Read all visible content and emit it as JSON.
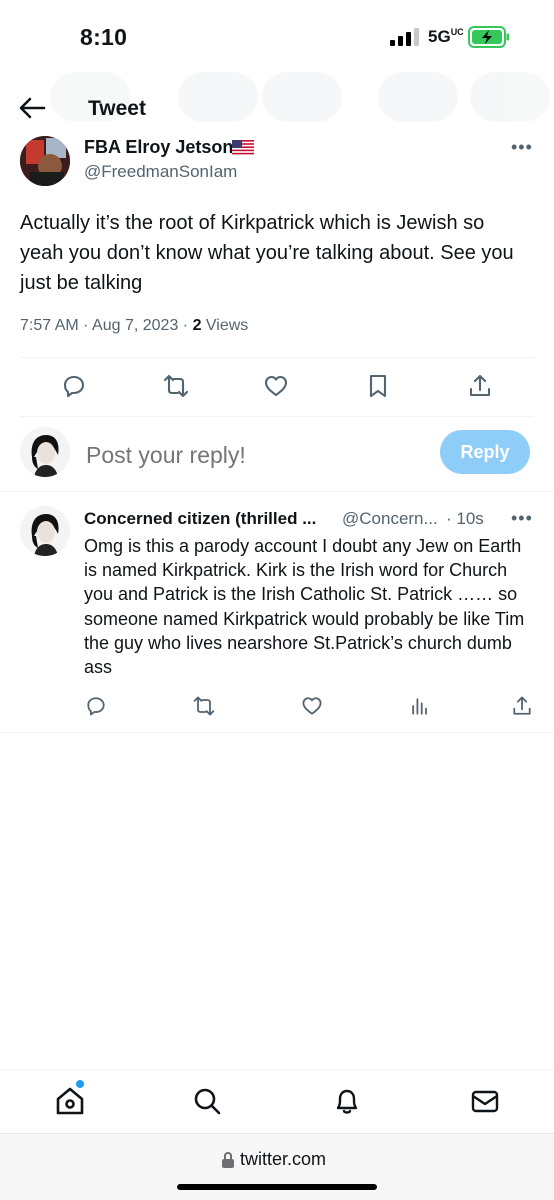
{
  "status_bar": {
    "time": "8:10",
    "network": "5G",
    "network_suffix": "UC",
    "battery_color": "#34c759"
  },
  "header": {
    "title": "Tweet",
    "back_icon": "arrow-left-icon"
  },
  "tweet": {
    "author_name": "FBA Elroy Jetson",
    "author_flag": "us-flag-icon",
    "author_handle": "@FreedmanSonIam",
    "text": "Actually it’s the root of Kirkpatrick which is Jewish so yeah you don’t know what you’re talking about. See you just be talking",
    "time": "7:57 AM · Aug 7, 2023 · ",
    "views_count": "2",
    "views_label": " Views",
    "more_label": "•••",
    "actions": [
      "reply-icon",
      "retweet-icon",
      "like-icon",
      "bookmark-icon",
      "share-icon"
    ]
  },
  "compose": {
    "placeholder": "Post your reply!",
    "reply_button": "Reply",
    "reply_button_color": "#8ecdf8"
  },
  "reply": {
    "author_name": "Concerned citizen (thrilled ...",
    "author_handle": "@Concern...",
    "time": "· 10s",
    "more_label": "•••",
    "text": "Omg is this a parody account I doubt any Jew on Earth is named Kirkpatrick. Kirk is the Irish word for Church you and Patrick is the Irish Catholic St. Patrick …… so someone named Kirkpatrick would probably be like Tim the guy who lives nearshore St.Patrick’s church dumb ass",
    "actions": [
      "reply-icon",
      "retweet-icon",
      "like-icon",
      "views-icon",
      "share-icon"
    ]
  },
  "bottom_nav": {
    "items": [
      "home-icon",
      "search-icon",
      "notifications-icon",
      "messages-icon"
    ],
    "accent": "#1d9bf0"
  },
  "browser": {
    "url": "twitter.com"
  }
}
